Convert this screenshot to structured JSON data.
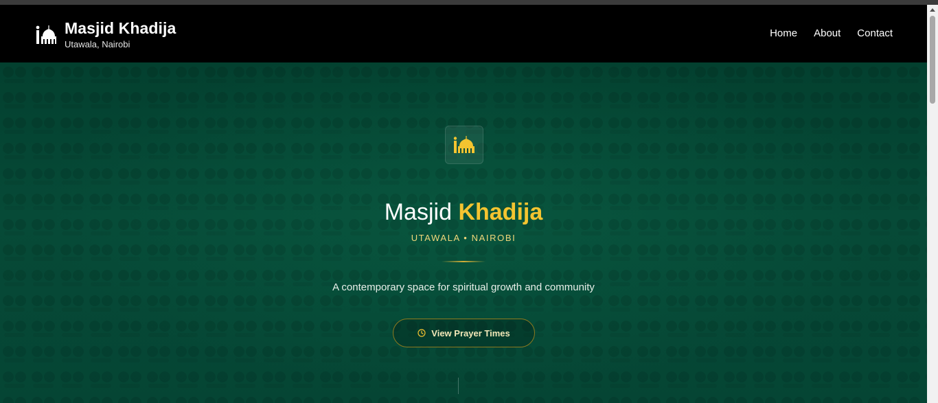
{
  "header": {
    "brand_title": "Masjid Khadija",
    "brand_subtitle": "Utawala, Nairobi",
    "brand_icon": "mosque-icon",
    "nav": [
      {
        "label": "Home"
      },
      {
        "label": "About"
      },
      {
        "label": "Contact"
      }
    ]
  },
  "hero": {
    "badge_icon": "mosque-icon",
    "title_plain": "Masjid",
    "title_accent": "Khadija",
    "location": "UTAWALA • NAIROBI",
    "tagline": "A contemporary space for spiritual growth and community",
    "cta_label": "View Prayer Times",
    "cta_icon": "clock-icon"
  },
  "colors": {
    "header_bg": "#000000",
    "hero_bg": "#054534",
    "accent_gold": "#f4c430",
    "cta_border": "#8d7a1f"
  }
}
